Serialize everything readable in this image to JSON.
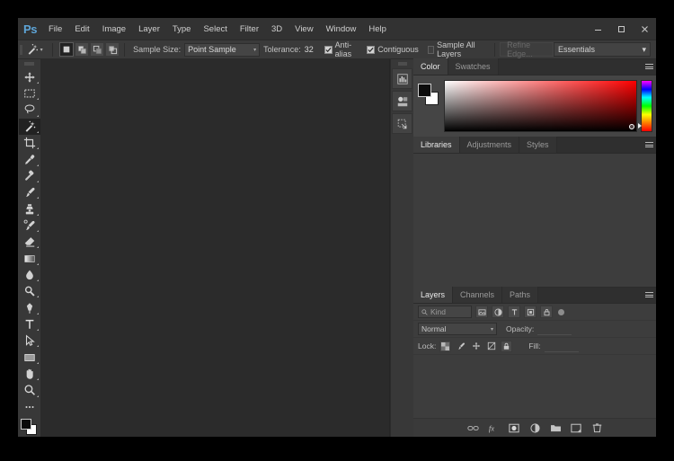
{
  "app": {
    "name": "Ps",
    "logo_text": "Ps"
  },
  "menubar": {
    "items": [
      "File",
      "Edit",
      "Image",
      "Layer",
      "Type",
      "Select",
      "Filter",
      "3D",
      "View",
      "Window",
      "Help"
    ]
  },
  "window_controls": {
    "minimize": "minimize",
    "maximize": "maximize",
    "close": "close"
  },
  "options_bar": {
    "active_tool": "magic-wand",
    "selection_modes": [
      "New selection",
      "Add to selection",
      "Subtract from selection",
      "Intersect with selection"
    ],
    "active_selection_mode": 0,
    "sample_size_label": "Sample Size:",
    "sample_size_value": "Point Sample",
    "tolerance_label": "Tolerance:",
    "tolerance_value": "32",
    "anti_alias_label": "Anti-alias",
    "anti_alias_checked": true,
    "contiguous_label": "Contiguous",
    "contiguous_checked": true,
    "sample_all_layers_label": "Sample All Layers",
    "sample_all_layers_checked": false,
    "refine_edge_label": "Refine Edge...",
    "refine_edge_disabled": true,
    "workspace_value": "Essentials"
  },
  "toolbar": {
    "tools": [
      {
        "name": "move-tool",
        "label": "Move Tool",
        "active": false
      },
      {
        "name": "rectangular-marquee-tool",
        "label": "Rectangular Marquee Tool",
        "active": false
      },
      {
        "name": "lasso-tool",
        "label": "Lasso Tool",
        "active": false
      },
      {
        "name": "magic-wand-tool",
        "label": "Magic Wand Tool",
        "active": true
      },
      {
        "name": "crop-tool",
        "label": "Crop Tool",
        "active": false
      },
      {
        "name": "eyedropper-tool",
        "label": "Eyedropper Tool",
        "active": false
      },
      {
        "name": "spot-healing-brush-tool",
        "label": "Spot Healing Brush Tool",
        "active": false
      },
      {
        "name": "brush-tool",
        "label": "Brush Tool",
        "active": false
      },
      {
        "name": "clone-stamp-tool",
        "label": "Clone Stamp Tool",
        "active": false
      },
      {
        "name": "history-brush-tool",
        "label": "History Brush Tool",
        "active": false
      },
      {
        "name": "eraser-tool",
        "label": "Eraser Tool",
        "active": false
      },
      {
        "name": "gradient-tool",
        "label": "Gradient Tool",
        "active": false
      },
      {
        "name": "blur-tool",
        "label": "Blur Tool",
        "active": false
      },
      {
        "name": "dodge-tool",
        "label": "Dodge Tool",
        "active": false
      },
      {
        "name": "pen-tool",
        "label": "Pen Tool",
        "active": false
      },
      {
        "name": "horizontal-type-tool",
        "label": "Horizontal Type Tool",
        "active": false
      },
      {
        "name": "path-selection-tool",
        "label": "Path Selection Tool",
        "active": false
      },
      {
        "name": "rectangle-tool",
        "label": "Rectangle Tool",
        "active": false
      },
      {
        "name": "hand-tool",
        "label": "Hand Tool",
        "active": false
      },
      {
        "name": "zoom-tool",
        "label": "Zoom Tool",
        "active": false
      },
      {
        "name": "edit-toolbar",
        "label": "Edit Toolbar",
        "active": false
      }
    ],
    "foreground_color": "#000000",
    "background_color": "#ffffff"
  },
  "dock_rail": {
    "buttons": [
      "histogram-panel",
      "adjustments-panel",
      "libraries-panel"
    ]
  },
  "color_panel": {
    "tabs": [
      {
        "label": "Color",
        "active": true
      },
      {
        "label": "Swatches",
        "active": false
      }
    ],
    "foreground_color": "#000000",
    "background_color": "#ffffff",
    "field_base_hue": "#ff0000"
  },
  "libraries_panel": {
    "tabs": [
      {
        "label": "Libraries",
        "active": true
      },
      {
        "label": "Adjustments",
        "active": false
      },
      {
        "label": "Styles",
        "active": false
      }
    ]
  },
  "layers_panel": {
    "tabs": [
      {
        "label": "Layers",
        "active": true
      },
      {
        "label": "Channels",
        "active": false
      },
      {
        "label": "Paths",
        "active": false
      }
    ],
    "filter_kind_label": "Kind",
    "filter_icons": [
      "pixel-layers-filter",
      "adjustment-layers-filter",
      "type-layers-filter",
      "shape-layers-filter",
      "smart-object-filter"
    ],
    "blend_mode": "Normal",
    "opacity_label": "Opacity:",
    "opacity_value": "",
    "lock_label": "Lock:",
    "lock_icons": [
      "lock-transparent-pixels",
      "lock-image-pixels",
      "lock-position",
      "lock-artboard-nesting",
      "lock-all"
    ],
    "fill_label": "Fill:",
    "fill_value": "",
    "footer_icons": [
      "link-layers-icon",
      "add-layer-style-icon",
      "add-layer-mask-icon",
      "new-adjustment-layer-icon",
      "new-group-icon",
      "new-layer-icon",
      "delete-layer-icon"
    ],
    "layers": []
  },
  "colors": {
    "chrome": "#323232",
    "panel": "#3a3a3a",
    "canvas": "#2b2b2b",
    "accent": "#5ea5d8",
    "text": "#c8c8c8"
  }
}
